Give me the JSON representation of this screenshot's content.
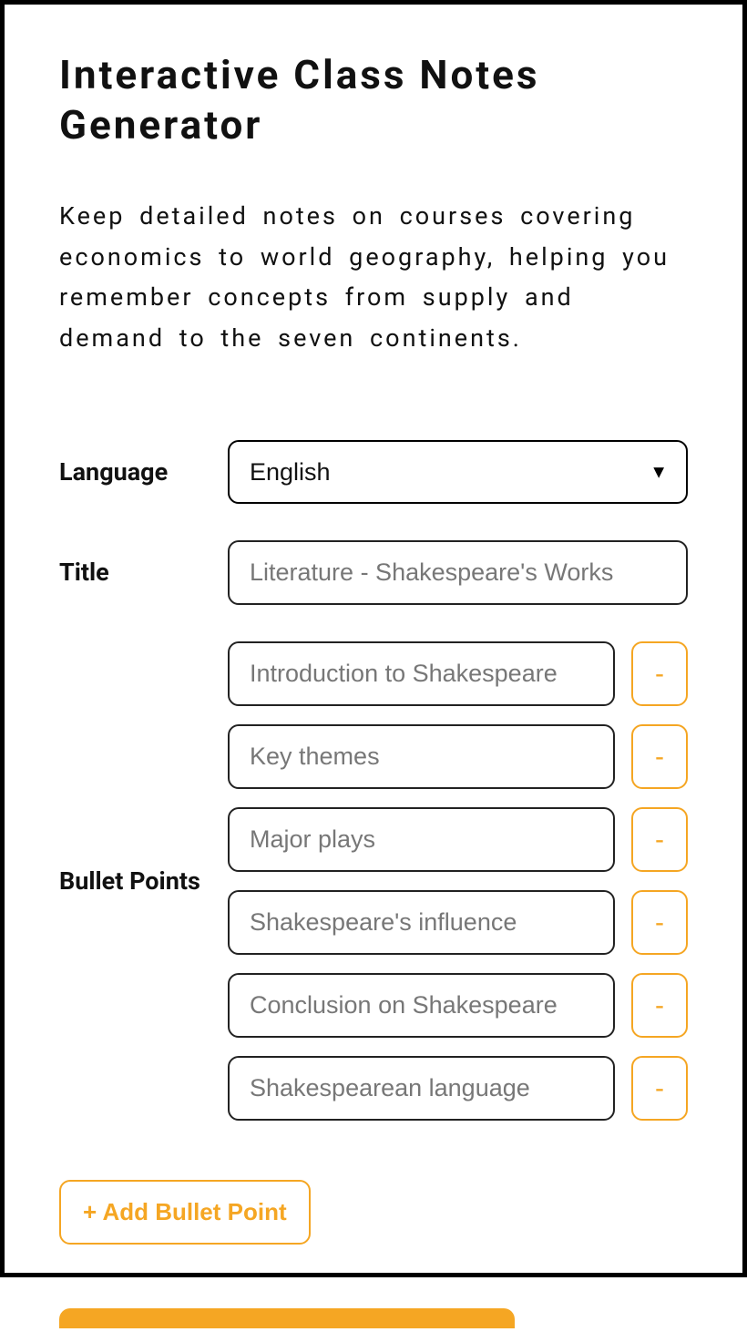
{
  "header": {
    "title": "Interactive Class Notes Generator"
  },
  "description": "Keep detailed notes on courses covering economics to world geography, helping you remember concepts from supply and demand to the seven continents.",
  "form": {
    "language": {
      "label": "Language",
      "selected": "English"
    },
    "title": {
      "label": "Title",
      "placeholder": "Literature - Shakespeare's Works",
      "value": ""
    },
    "bullets": {
      "label": "Bullet Points",
      "items": [
        {
          "placeholder": "Introduction to Shakespeare",
          "value": ""
        },
        {
          "placeholder": "Key themes",
          "value": ""
        },
        {
          "placeholder": "Major plays",
          "value": ""
        },
        {
          "placeholder": "Shakespeare's influence",
          "value": ""
        },
        {
          "placeholder": "Conclusion on Shakespeare",
          "value": ""
        },
        {
          "placeholder": "Shakespearean language",
          "value": ""
        }
      ],
      "remove_label": "-",
      "add_label": "+ Add Bullet Point"
    }
  }
}
